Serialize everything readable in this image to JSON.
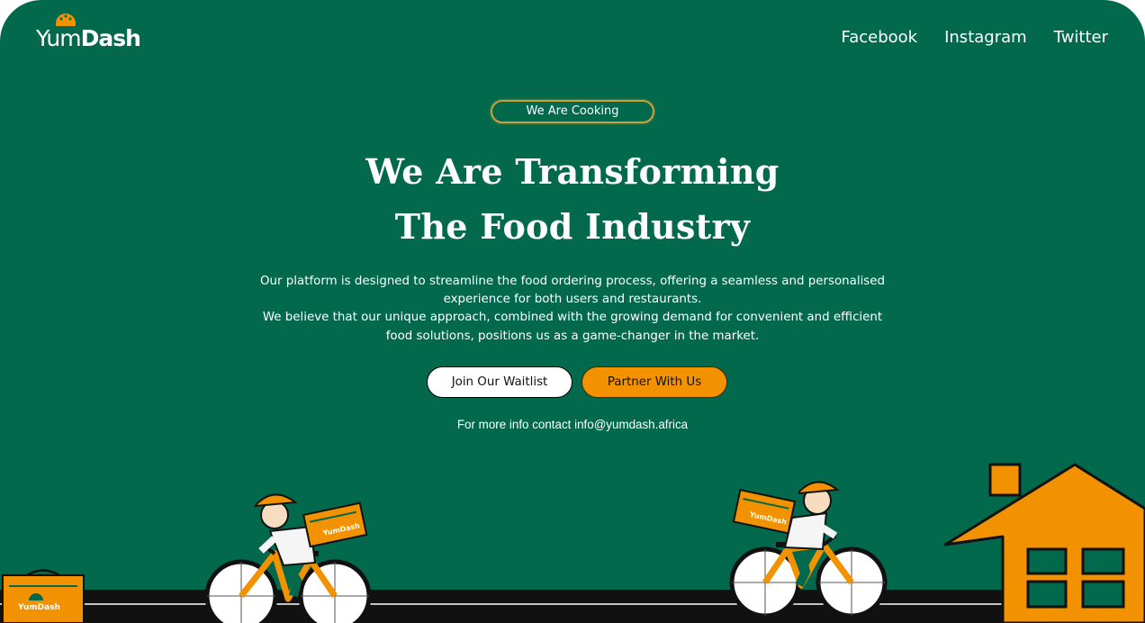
{
  "brand": {
    "name_light": "Yum",
    "name_bold": "Dash",
    "logo_icon": "food-bowl-icon",
    "box_label": "YumDash"
  },
  "nav": {
    "facebook": "Facebook",
    "instagram": "Instagram",
    "twitter": "Twitter"
  },
  "hero": {
    "badge": "We Are Cooking",
    "headline_line1": "We Are Transforming",
    "headline_line2": "The Food Industry",
    "description_p1": "Our platform is designed to streamline the food ordering process, offering a seamless and personalised experience for both users and restaurants.",
    "description_p2": "We believe that our unique approach, combined with the growing demand for convenient and efficient food solutions, positions us as a game-changer in the market.",
    "cta_waitlist": "Join Our Waitlist",
    "cta_partner": "Partner With Us",
    "contact": "For more info contact info@yumdash.africa"
  },
  "colors": {
    "background": "#02694c",
    "accent_orange": "#f39200",
    "badge_border": "#c8a23c",
    "text": "#ffffff"
  }
}
